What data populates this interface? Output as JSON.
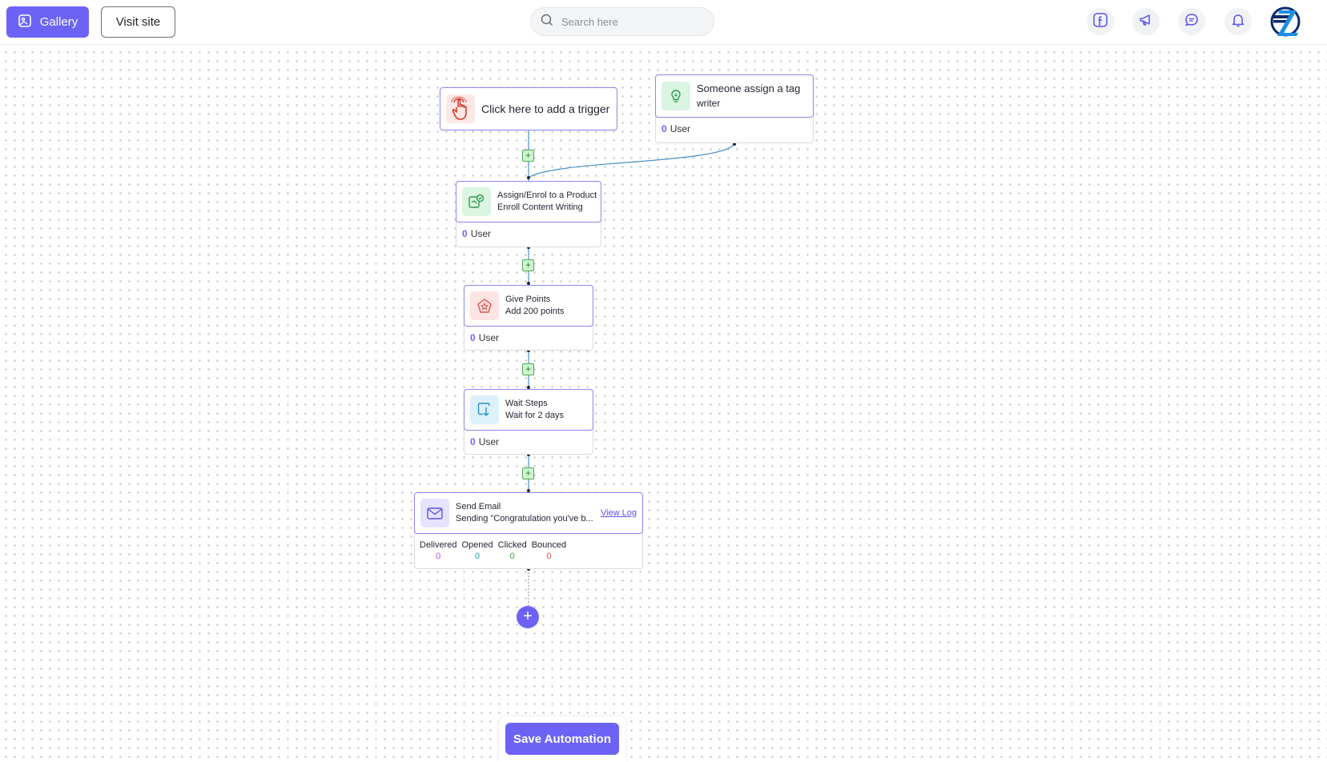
{
  "header": {
    "gallery_label": "Gallery",
    "visit_site_label": "Visit site",
    "search_placeholder": "Search here",
    "icons": [
      "facebook-icon",
      "megaphone-icon",
      "chat-icon",
      "bell-icon"
    ]
  },
  "nodes": {
    "trigger": {
      "label": "Click here to add a trigger"
    },
    "tag_trigger": {
      "title": "Someone assign a tag",
      "subtitle": "writer",
      "count": "0",
      "count_label": "User"
    },
    "assign": {
      "title": "Assign/Enrol to a Product",
      "subtitle": "Enroll Content Writing",
      "count": "0",
      "count_label": "User"
    },
    "points": {
      "title": "Give Points",
      "subtitle": "Add 200 points",
      "count": "0",
      "count_label": "User"
    },
    "wait": {
      "title": "Wait Steps",
      "subtitle": "Wait for 2 days",
      "count": "0",
      "count_label": "User"
    },
    "email": {
      "title": "Send Email",
      "subtitle": "Sending \"Congratulation you've b...",
      "view_log": "View Log",
      "stats": [
        {
          "label": "Delivered",
          "value": "0",
          "color": "#b44fd8"
        },
        {
          "label": "Opened",
          "value": "0",
          "color": "#2aa39a"
        },
        {
          "label": "Clicked",
          "value": "0",
          "color": "#3aa84a"
        },
        {
          "label": "Bounced",
          "value": "0",
          "color": "#e0483e"
        }
      ]
    }
  },
  "add_step_symbol": "+",
  "save_label": "Save Automation",
  "colors": {
    "accent": "#6c63f6",
    "wire": "#4a90c8",
    "plus_bg": "#cdf5cf"
  }
}
